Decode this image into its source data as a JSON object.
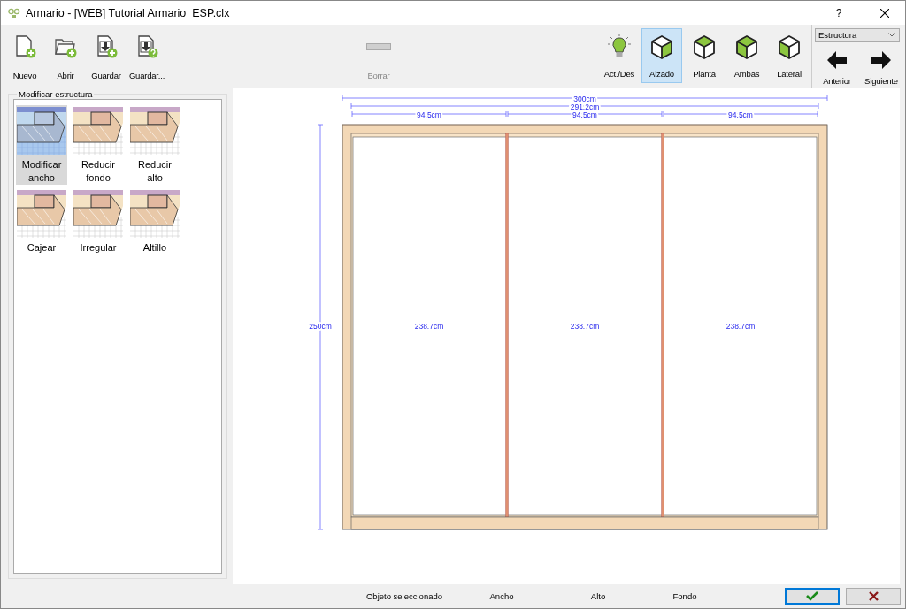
{
  "window": {
    "title": "Armario - [WEB] Tutorial Armario_ESP.clx",
    "help": "?"
  },
  "toolbar": {
    "file_buttons": [
      {
        "label": "Nuevo",
        "disabled": false
      },
      {
        "label": "Abrir",
        "disabled": false
      },
      {
        "label": "Guardar",
        "disabled": false
      },
      {
        "label": "Guardar...",
        "disabled": false
      }
    ],
    "delete_button": {
      "label": "Borrar",
      "disabled": true
    },
    "view_buttons": [
      {
        "label": "Act./Des",
        "selected": false
      },
      {
        "label": "Alzado",
        "selected": true
      },
      {
        "label": "Planta",
        "selected": false
      },
      {
        "label": "Ambas",
        "selected": false
      },
      {
        "label": "Lateral",
        "selected": false
      }
    ],
    "mode_dropdown": {
      "value": "Estructura"
    },
    "nav_buttons": [
      {
        "label": "Anterior"
      },
      {
        "label": "Siguiente"
      }
    ]
  },
  "panel": {
    "title": "Modificar estructura",
    "tools": [
      {
        "label": "Modificar ancho",
        "selected": true
      },
      {
        "label": "Reducir fondo",
        "selected": false
      },
      {
        "label": "Reducir alto",
        "selected": false
      },
      {
        "label": "Cajear",
        "selected": false
      },
      {
        "label": "Irregular",
        "selected": false
      },
      {
        "label": "Altillo",
        "selected": false
      }
    ]
  },
  "drawing": {
    "total_width": "300cm",
    "inner_width": "291.2cm",
    "height": "250cm",
    "sections": [
      {
        "width": "94.5cm",
        "height": "238.7cm"
      },
      {
        "width": "94.5cm",
        "height": "238.7cm"
      },
      {
        "width": "94.5cm",
        "height": "238.7cm"
      }
    ]
  },
  "status_bar": {
    "labels": [
      "Objeto seleccionado",
      "Ancho",
      "Alto",
      "Fondo"
    ]
  }
}
